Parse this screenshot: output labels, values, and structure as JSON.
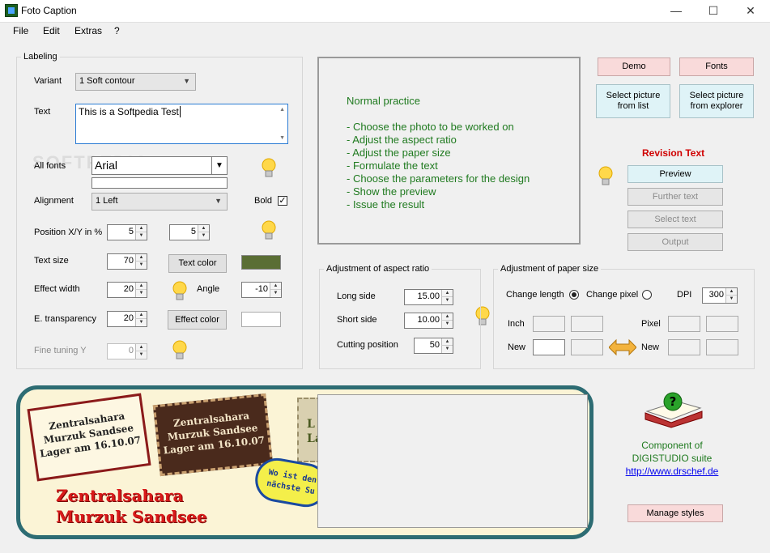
{
  "window": {
    "title": "Foto Caption",
    "minimize": "—",
    "maximize": "☐",
    "close": "✕"
  },
  "menu": [
    "File",
    "Edit",
    "Extras",
    "?"
  ],
  "labeling": {
    "legend": "Labeling",
    "variant_label": "Variant",
    "variant_value": "1 Soft contour",
    "text_label": "Text",
    "text_value": "This is a Softpedia Test",
    "all_fonts_label": "All fonts",
    "font_value": "Arial",
    "alignment_label": "Alignment",
    "alignment_value": "1 Left",
    "bold_label": "Bold",
    "bold_mark": "✓",
    "position_label": "Position X/Y in %",
    "pos_x": "5",
    "pos_y": "5",
    "text_size_label": "Text size",
    "text_size": "70",
    "text_color_btn": "Text color",
    "effect_width_label": "Effect width",
    "effect_width": "20",
    "angle_label": "Angle",
    "angle": "-10",
    "transparency_label": "E. transparency",
    "transparency": "20",
    "effect_color_btn": "Effect color",
    "fine_tuning_label": "Fine tuning Y",
    "fine_tuning": "0"
  },
  "info": {
    "title": "Normal practice",
    "lines": [
      "- Choose the photo to be worked on",
      "- Adjust the aspect ratio",
      "- Adjust the paper size",
      "- Formulate the text",
      "- Choose the parameters for the design",
      "- Show the preview",
      "- Issue the result"
    ]
  },
  "right_buttons": {
    "demo": "Demo",
    "fonts": "Fonts",
    "select_list": "Select picture from list",
    "select_explorer": "Select picture from explorer",
    "revision_title": "Revision Text",
    "preview": "Preview",
    "further_text": "Further text",
    "select_text": "Select text",
    "output": "Output"
  },
  "aspect": {
    "legend": "Adjustment of aspect ratio",
    "long_label": "Long side",
    "long_value": "15.00",
    "short_label": "Short side",
    "short_value": "10.00",
    "cut_label": "Cutting position",
    "cut_value": "50"
  },
  "paper": {
    "legend": "Adjustment of paper size",
    "change_length": "Change length",
    "change_pixel": "Change pixel",
    "dpi_label": "DPI",
    "dpi_value": "300",
    "inch_label": "Inch",
    "pixel_label": "Pixel",
    "new_label_left": "New",
    "new_label_right": "New"
  },
  "preview_samples": {
    "stamp1": [
      "Zentralsahara",
      "Murzuk Sandsee",
      "Lager am 16.10.07"
    ],
    "stamp2": [
      "Zentralsahara",
      "Murzuk Sandsee",
      "Lager am 16.10.07"
    ],
    "stamp3": [
      "L",
      "La"
    ],
    "bubble": [
      "Wo ist den",
      "nächste Su"
    ],
    "big": [
      "Zentralsahara",
      "Murzuk Sandsee"
    ]
  },
  "component": {
    "line1": "Component of",
    "line2": "DIGISTUDIO suite",
    "url": "http://www.drschef.de",
    "manage_styles": "Manage styles"
  },
  "colors": {
    "text_color": "#5a6e34",
    "effect_color": "#ffffff",
    "info_green": "#1f7a1f",
    "revision_red": "#d00000"
  },
  "watermark": "SOFTPEDIA"
}
